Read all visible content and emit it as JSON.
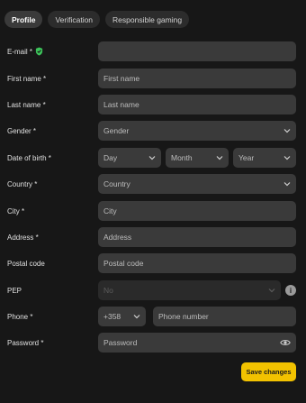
{
  "tabs": [
    {
      "label": "Profile",
      "active": true
    },
    {
      "label": "Verification",
      "active": false
    },
    {
      "label": "Responsible gaming",
      "active": false
    }
  ],
  "form": {
    "email": {
      "label": "E-mail *",
      "value": "",
      "verified_icon": "shield-check-icon"
    },
    "first_name": {
      "label": "First name *",
      "placeholder": "First name"
    },
    "last_name": {
      "label": "Last name *",
      "placeholder": "Last name"
    },
    "gender": {
      "label": "Gender *",
      "placeholder": "Gender"
    },
    "dob": {
      "label": "Date of birth *",
      "day": "Day",
      "month": "Month",
      "year": "Year"
    },
    "country": {
      "label": "Country *",
      "placeholder": "Country"
    },
    "city": {
      "label": "City *",
      "placeholder": "City"
    },
    "address": {
      "label": "Address *",
      "placeholder": "Address"
    },
    "postal_code": {
      "label": "Postal code",
      "placeholder": "Postal code"
    },
    "pep": {
      "label": "PEP",
      "value": "No",
      "info_icon": "i"
    },
    "phone": {
      "label": "Phone *",
      "code": "+358",
      "placeholder": "Phone number"
    },
    "password": {
      "label": "Password *",
      "placeholder": "Password"
    }
  },
  "save_label": "Save changes",
  "colors": {
    "background": "#171717",
    "field": "#3a3a3a",
    "accent": "#f2c200",
    "verified": "#3cc45a"
  }
}
